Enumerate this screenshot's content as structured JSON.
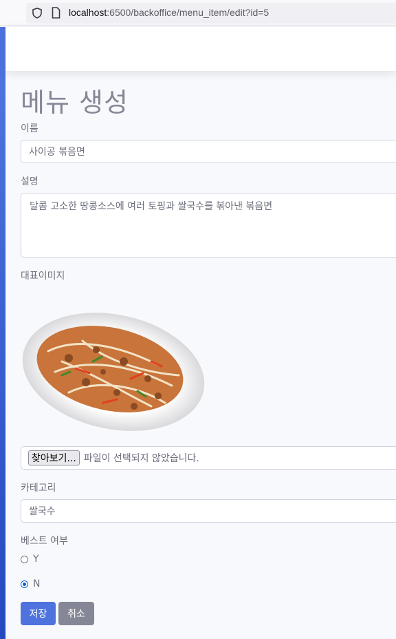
{
  "browser": {
    "url_host": "localhost",
    "url_rest": ":6500/backoffice/menu_item/edit?id=5"
  },
  "page": {
    "title": "메뉴 생성"
  },
  "form": {
    "name_label": "이름",
    "name_value": "사이공 볶음면",
    "description_label": "설명",
    "description_value": "달콤 고소한 땅콩소스에 여러 토핑과 쌀국수를 볶아낸 볶음면",
    "image_label": "대표이미지",
    "file_button_label": "찾아보기...",
    "file_status": "파일이 선택되지 않았습니다.",
    "category_label": "카테고리",
    "category_value": "쌀국수",
    "best_label": "베스트 여부",
    "best_options": [
      {
        "label": "Y",
        "checked": false
      },
      {
        "label": "N",
        "checked": true
      }
    ],
    "save_label": "저장",
    "cancel_label": "취소"
  },
  "colors": {
    "primary": "#4e73df",
    "secondary": "#858796",
    "radio_checked": "#0b63d5"
  }
}
